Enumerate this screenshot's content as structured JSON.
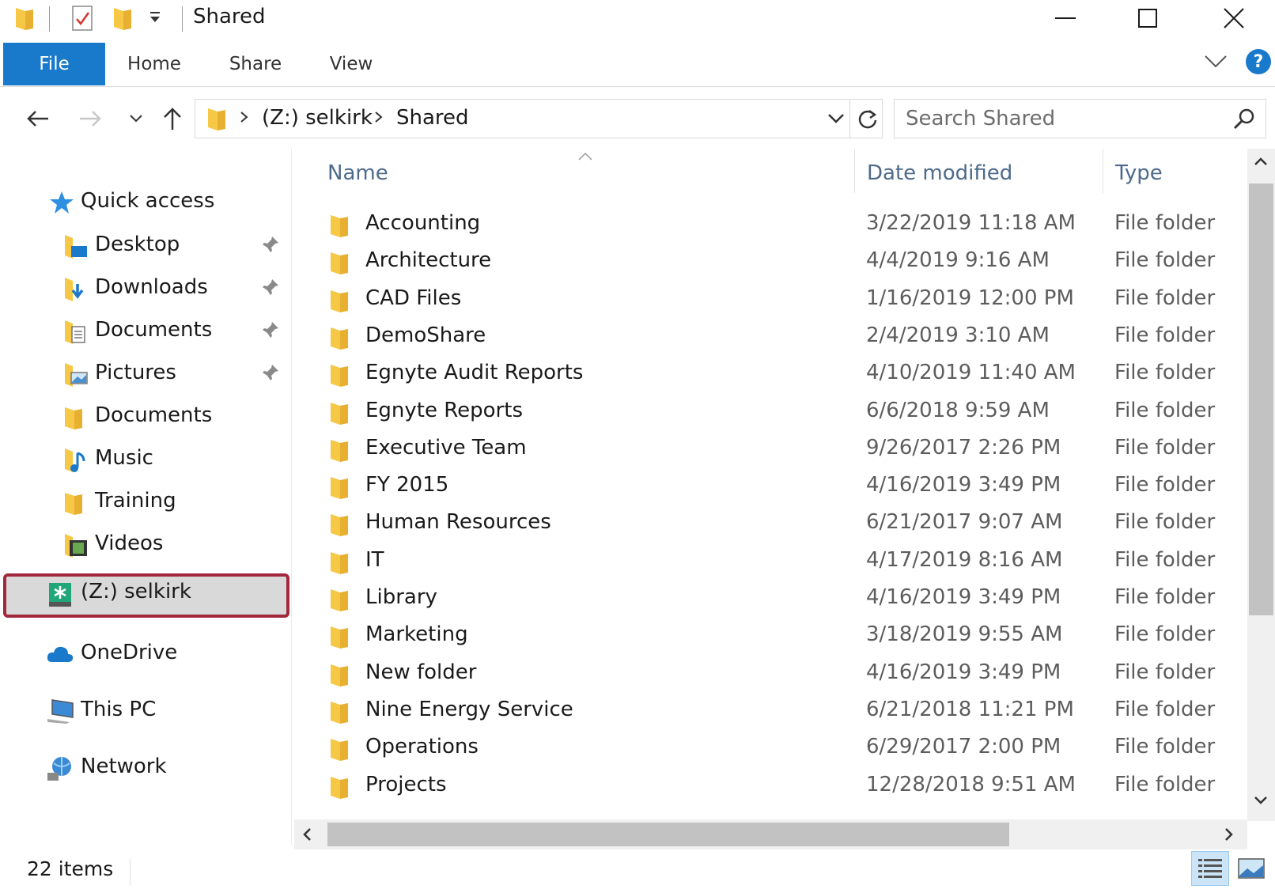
{
  "window": {
    "title": "Shared",
    "colors": {
      "accent": "#1979ca",
      "selection_outline": "#a3283d",
      "folder": "#f7c746"
    }
  },
  "ribbon": {
    "file": "File",
    "tabs": [
      "Home",
      "Share",
      "View"
    ],
    "help": "?"
  },
  "address": {
    "crumbs": [
      "(Z:) selkirk",
      "Shared"
    ],
    "search_placeholder": "Search Shared"
  },
  "nav": {
    "quick_access": "Quick access",
    "items": [
      {
        "label": "Desktop",
        "icon": "desktop-folder-icon",
        "pinned": true
      },
      {
        "label": "Downloads",
        "icon": "downloads-folder-icon",
        "pinned": true
      },
      {
        "label": "Documents",
        "icon": "documents-folder-icon",
        "pinned": true
      },
      {
        "label": "Pictures",
        "icon": "pictures-folder-icon",
        "pinned": true
      },
      {
        "label": "Documents",
        "icon": "folder-icon",
        "pinned": false
      },
      {
        "label": "Music",
        "icon": "music-folder-icon",
        "pinned": false
      },
      {
        "label": "Training",
        "icon": "folder-icon",
        "pinned": false
      },
      {
        "label": "Videos",
        "icon": "videos-folder-icon",
        "pinned": false
      }
    ],
    "drive": "(Z:) selkirk",
    "onedrive": "OneDrive",
    "thispc": "This PC",
    "network": "Network"
  },
  "list": {
    "columns": {
      "name": "Name",
      "date": "Date modified",
      "type": "Type"
    },
    "rows": [
      {
        "name": "Accounting",
        "date": "3/22/2019 11:18 AM",
        "type": "File folder"
      },
      {
        "name": "Architecture",
        "date": "4/4/2019 9:16 AM",
        "type": "File folder"
      },
      {
        "name": "CAD Files",
        "date": "1/16/2019 12:00 PM",
        "type": "File folder"
      },
      {
        "name": "DemoShare",
        "date": "2/4/2019 3:10 AM",
        "type": "File folder"
      },
      {
        "name": "Egnyte Audit Reports",
        "date": "4/10/2019 11:40 AM",
        "type": "File folder"
      },
      {
        "name": "Egnyte Reports",
        "date": "6/6/2018 9:59 AM",
        "type": "File folder"
      },
      {
        "name": "Executive Team",
        "date": "9/26/2017 2:26 PM",
        "type": "File folder"
      },
      {
        "name": "FY 2015",
        "date": "4/16/2019 3:49 PM",
        "type": "File folder"
      },
      {
        "name": "Human Resources",
        "date": "6/21/2017 9:07 AM",
        "type": "File folder"
      },
      {
        "name": "IT",
        "date": "4/17/2019 8:16 AM",
        "type": "File folder"
      },
      {
        "name": "Library",
        "date": "4/16/2019 3:49 PM",
        "type": "File folder"
      },
      {
        "name": "Marketing",
        "date": "3/18/2019 9:55 AM",
        "type": "File folder"
      },
      {
        "name": "New folder",
        "date": "4/16/2019 3:49 PM",
        "type": "File folder"
      },
      {
        "name": "Nine Energy Service",
        "date": "6/21/2018 11:21 PM",
        "type": "File folder"
      },
      {
        "name": "Operations",
        "date": "6/29/2017 2:00 PM",
        "type": "File folder"
      },
      {
        "name": "Projects",
        "date": "12/28/2018 9:51 AM",
        "type": "File folder"
      }
    ]
  },
  "status": {
    "count": "22 items"
  }
}
